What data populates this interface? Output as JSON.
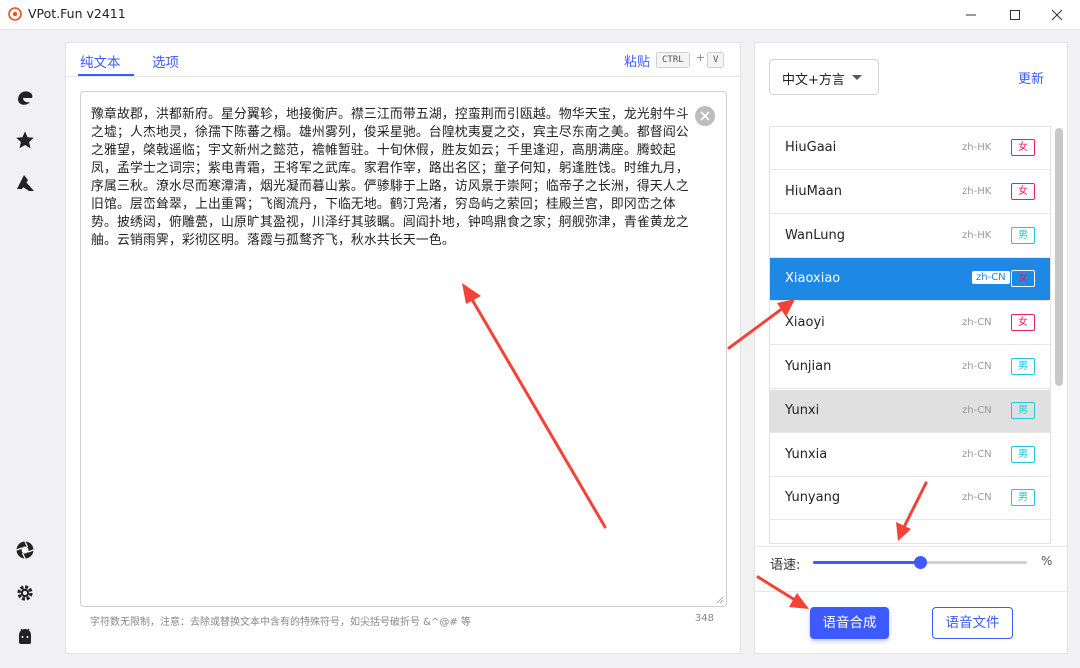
{
  "window": {
    "title": "VPot.Fun v2411"
  },
  "tabs": {
    "plain_text": "纯文本",
    "options": "选项"
  },
  "paste": {
    "label": "粘贴",
    "key1": "CTRL",
    "plus": "+",
    "key2": "V"
  },
  "editor": {
    "text": "豫章故郡，洪都新府。星分翼轸，地接衡庐。襟三江而带五湖，控蛮荆而引瓯越。物华天宝，龙光射牛斗之墟；人杰地灵，徐孺下陈蕃之榻。雄州雾列，俊采星驰。台隍枕夷夏之交，宾主尽东南之美。都督阎公之雅望，棨戟遥临；宇文新州之懿范，襜帷暂驻。十旬休假，胜友如云；千里逢迎，高朋满座。腾蛟起凤，孟学士之词宗；紫电青霜，王将军之武库。家君作宰，路出名区；童子何知，躬逢胜饯。时维九月，序属三秋。潦水尽而寒潭清，烟光凝而暮山紫。俨骖騑于上路，访风景于崇阿；临帝子之长洲，得天人之旧馆。层峦耸翠，上出重霄；飞阁流丹，下临无地。鹤汀凫渚，穷岛屿之萦回；桂殿兰宫，即冈峦之体势。披绣闼，俯雕甍，山原旷其盈视，川泽纡其骇瞩。闾阎扑地，钟鸣鼎食之家；舸舰弥津，青雀黄龙之舳。云销雨霁，彩彻区明。落霞与孤鹜齐飞，秋水共长天一色。",
    "hint": "字符数无限制，注意：去除或替换文本中含有的特殊符号，如尖括号破折号 &^@# 等",
    "char_count": "348"
  },
  "right_panel": {
    "language": "中文+方言",
    "update": "更新",
    "voices": [
      {
        "name": "HiuGaai",
        "code": "zh-HK",
        "gender": "女",
        "g": "f"
      },
      {
        "name": "HiuMaan",
        "code": "zh-HK",
        "gender": "女",
        "g": "f"
      },
      {
        "name": "WanLung",
        "code": "zh-HK",
        "gender": "男",
        "g": "m"
      },
      {
        "name": "Xiaoxiao",
        "code": "zh-CN",
        "gender": "女",
        "g": "f",
        "selected": true
      },
      {
        "name": "Xiaoyi",
        "code": "zh-CN",
        "gender": "女",
        "g": "f"
      },
      {
        "name": "Yunjian",
        "code": "zh-CN",
        "gender": "男",
        "g": "m"
      },
      {
        "name": "Yunxi",
        "code": "zh-CN",
        "gender": "男",
        "g": "m",
        "hover": true
      },
      {
        "name": "Yunxia",
        "code": "zh-CN",
        "gender": "男",
        "g": "m"
      },
      {
        "name": "Yunyang",
        "code": "zh-CN",
        "gender": "男",
        "g": "m"
      }
    ],
    "speed_label": "语速:",
    "speed_level": 0.5,
    "percent": "%",
    "synthesize": "语音合成",
    "voice_file": "语音文件"
  },
  "colors": {
    "accent": "#3d5afe",
    "selected_row": "#1e88e5",
    "female": "#e91e63",
    "male": "#26c6da",
    "annotation": "#f44336"
  },
  "icons": {
    "nav": [
      "edge-icon",
      "star-icon",
      "azure-icon",
      "shutter-icon",
      "settings-icon",
      "android-icon"
    ]
  }
}
